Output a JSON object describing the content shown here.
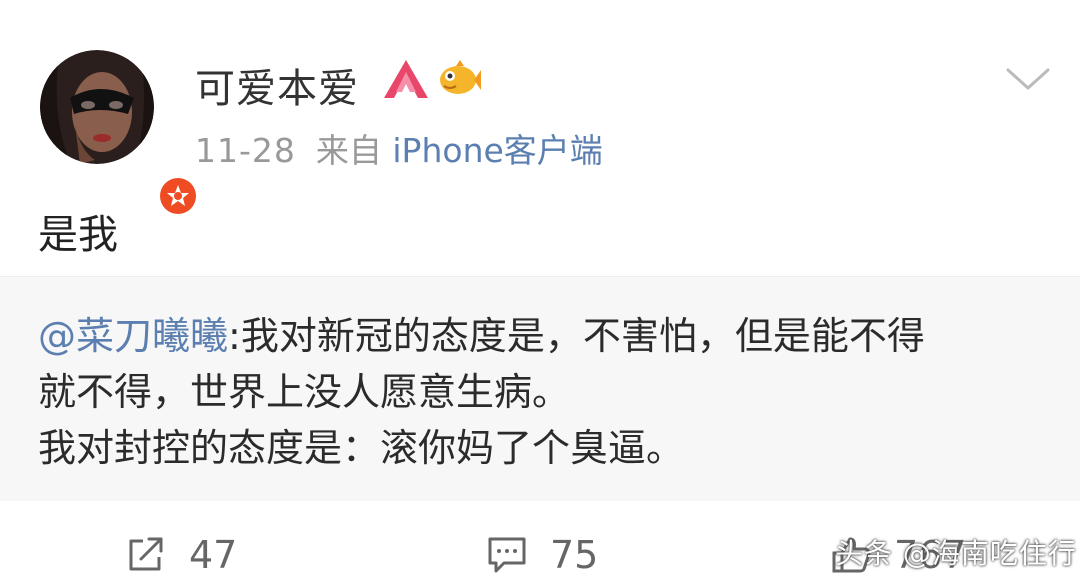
{
  "post": {
    "username": "可爱本爱",
    "date": "11-28",
    "from_label": "来自",
    "source": "iPhone客户端",
    "text": "是我"
  },
  "repost": {
    "mention": "@菜刀曦曦",
    "line1_rest": ":我对新冠的态度是，不害怕，但是能不得",
    "line2": "就不得，世界上没人愿意生病。",
    "line3": "我对封控的态度是：滚你妈了个臭逼。"
  },
  "actions": {
    "repost_count": "47",
    "comment_count": "75",
    "like_count": "767"
  },
  "watermark": "头条 @海南吃住行",
  "icons": [
    "verified-icon",
    "vip-icon",
    "fish-icon",
    "chevron-down-icon",
    "repost-icon",
    "comment-icon",
    "like-icon"
  ],
  "colors": {
    "link": "#5b7fb0",
    "meta": "#999999",
    "repost_bg": "#f7f7f7",
    "badge": "#f04c23"
  }
}
